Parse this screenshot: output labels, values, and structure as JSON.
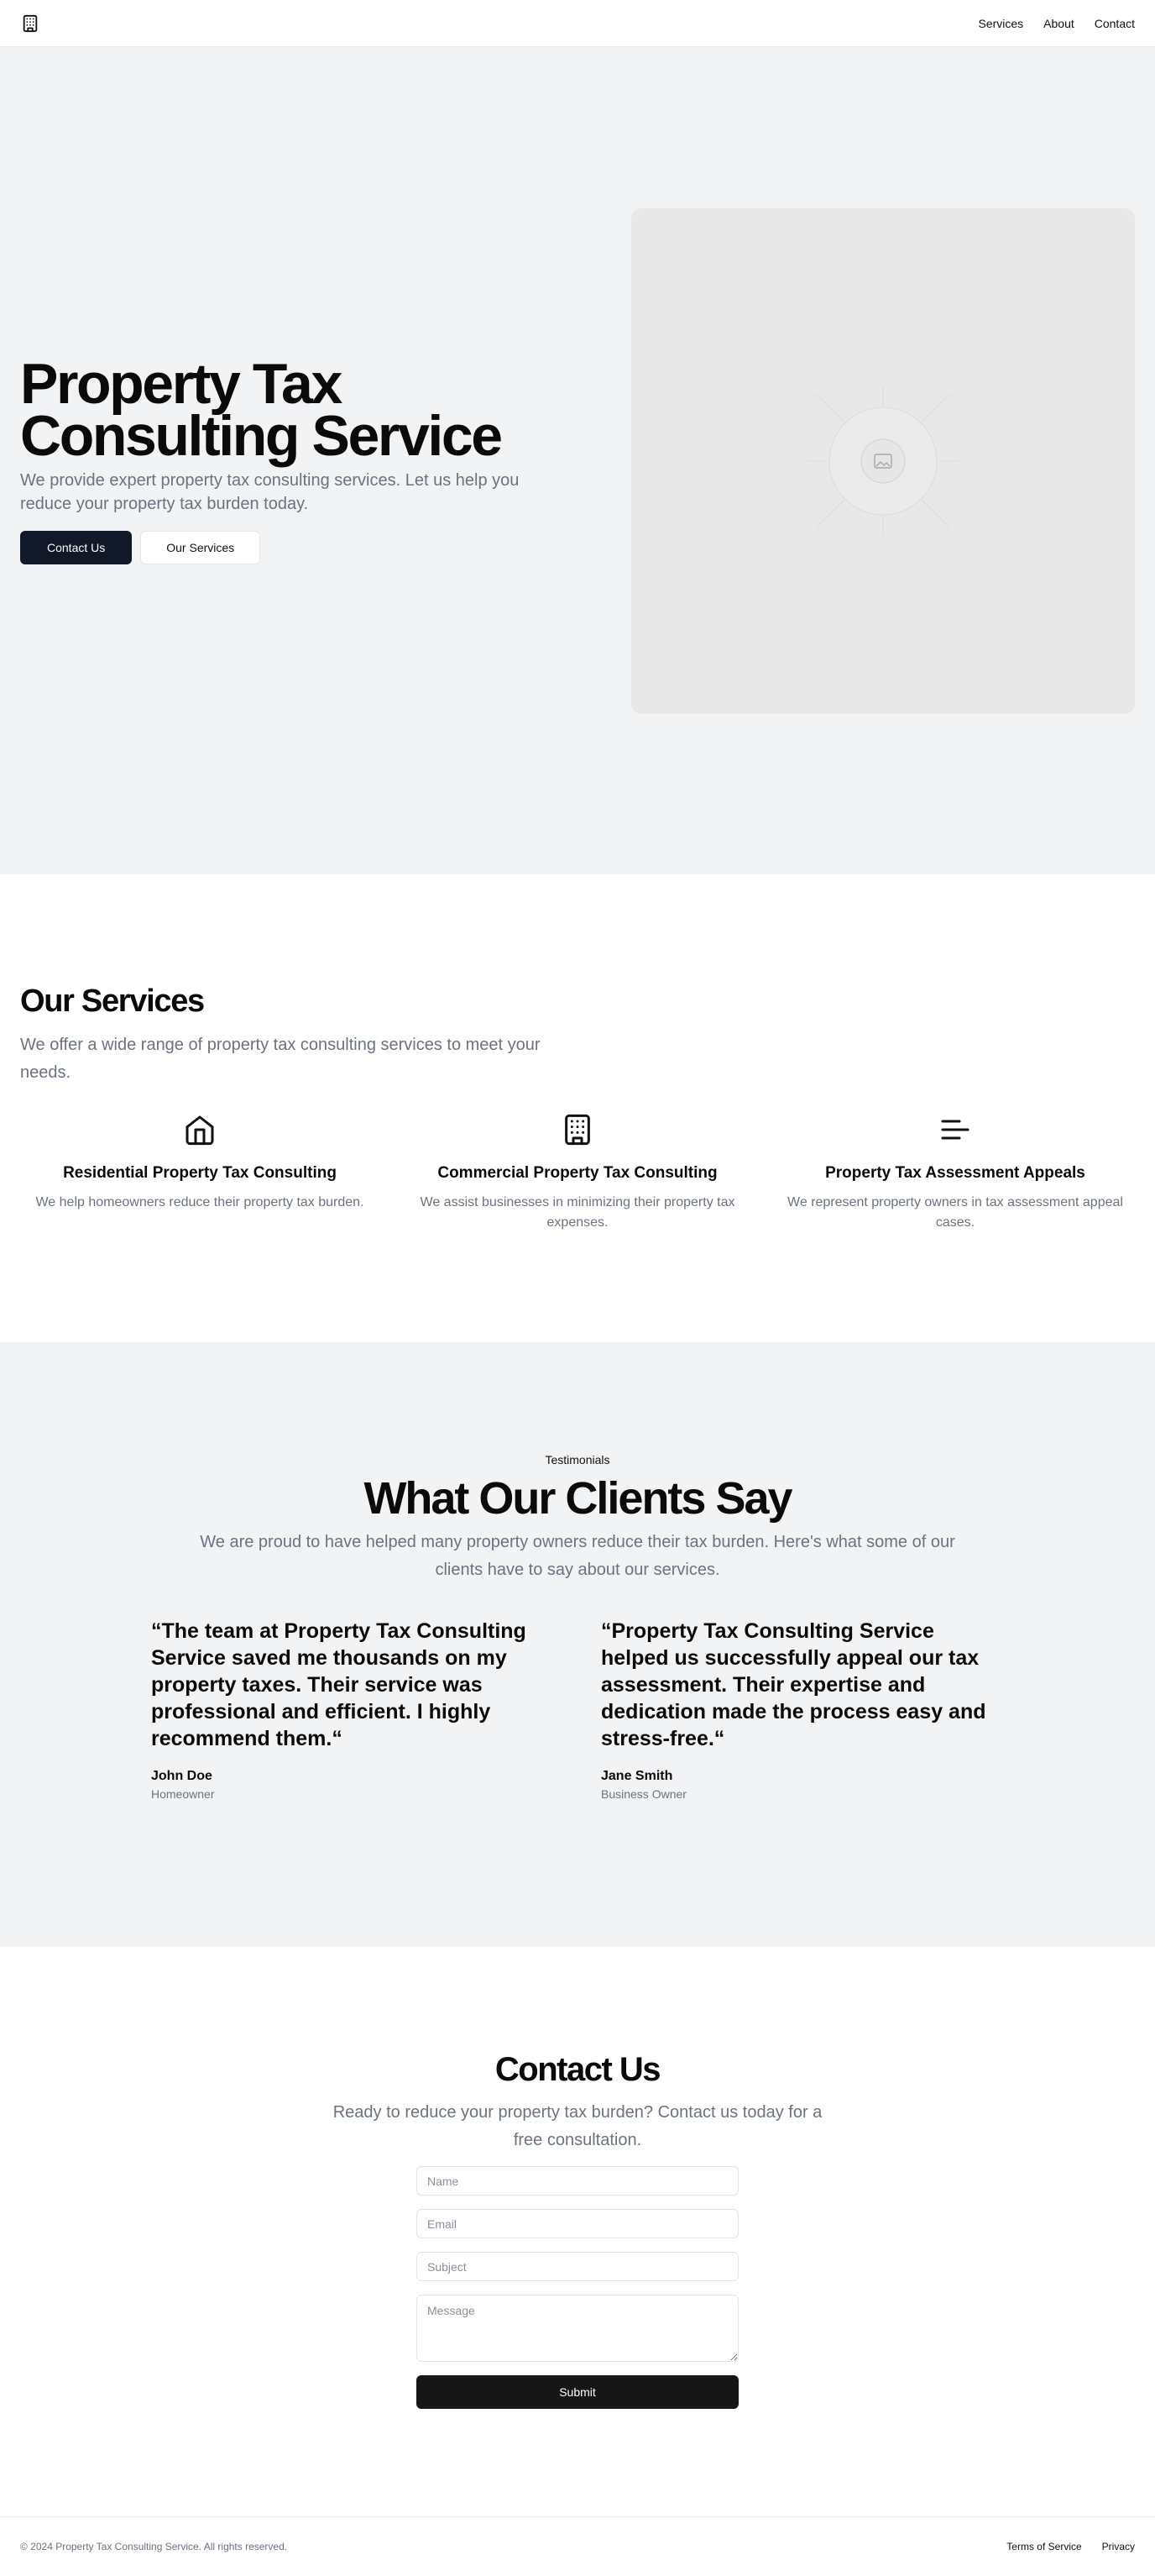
{
  "nav": {
    "logo_icon": "building-icon",
    "links": [
      "Services",
      "About",
      "Contact"
    ]
  },
  "hero": {
    "title": "Property Tax Consulting Service",
    "subtitle": "We provide expert property tax consulting services. Let us help you reduce your property tax burden today.",
    "primary_button": "Contact Us",
    "secondary_button": "Our Services",
    "image_icon": "image-placeholder-icon"
  },
  "services": {
    "title": "Our Services",
    "subtitle": "We offer a wide range of property tax consulting services to meet your needs.",
    "items": [
      {
        "icon": "home-icon",
        "title": "Residential Property Tax Consulting",
        "description": "We help homeowners reduce their property tax burden."
      },
      {
        "icon": "building-icon",
        "title": "Commercial Property Tax Consulting",
        "description": "We assist businesses in minimizing their property tax expenses."
      },
      {
        "icon": "menu-lines-icon",
        "title": "Property Tax Assessment Appeals",
        "description": "We represent property owners in tax assessment appeal cases."
      }
    ]
  },
  "testimonials": {
    "eyebrow": "Testimonials",
    "title": "What Our Clients Say",
    "subtitle": "We are proud to have helped many property owners reduce their tax burden. Here's what some of our clients have to say about our services.",
    "items": [
      {
        "quote": "“The team at Property Tax Consulting Service saved me thousands on my property taxes. Their service was professional and efficient. I highly recommend them.“",
        "name": "John Doe",
        "role": "Homeowner"
      },
      {
        "quote": "“Property Tax Consulting Service helped us successfully appeal our tax assessment. Their expertise and dedication made the process easy and stress-free.“",
        "name": "Jane Smith",
        "role": "Business Owner"
      }
    ]
  },
  "contact": {
    "title": "Contact Us",
    "subtitle": "Ready to reduce your property tax burden? Contact us today for a free consultation.",
    "name_placeholder": "Name",
    "email_placeholder": "Email",
    "subject_placeholder": "Subject",
    "message_placeholder": "Message",
    "submit_label": "Submit"
  },
  "footer": {
    "copyright": "© 2024 Property Tax Consulting Service. All rights reserved.",
    "links": [
      "Terms of Service",
      "Privacy"
    ]
  },
  "colors": {
    "accent": "#111827",
    "section_bg": "#f2f3f5",
    "muted_text": "#6b7280"
  }
}
